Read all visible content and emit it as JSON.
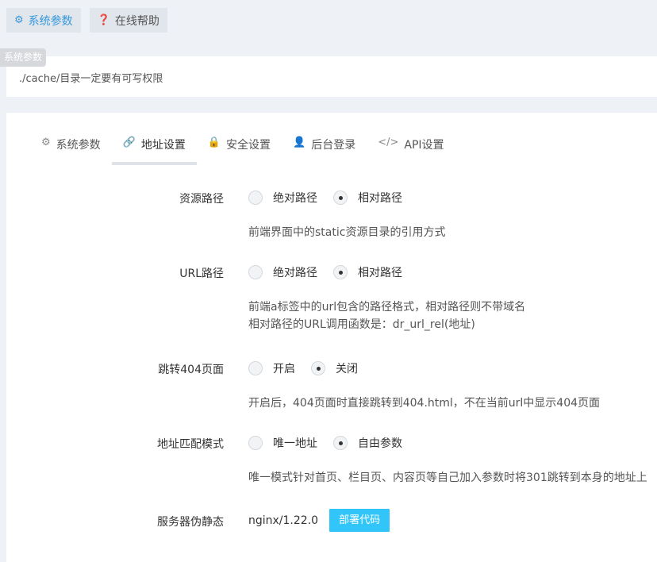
{
  "top_buttons": [
    {
      "label": "系统参数",
      "icon": "gear-icon"
    },
    {
      "label": "在线帮助",
      "icon": "question-circle-icon"
    }
  ],
  "tooltip": "系统参数",
  "note": "./cache/目录一定要有可写权限",
  "tabs": [
    {
      "label": "系统参数",
      "icon": "gear-icon"
    },
    {
      "label": "地址设置",
      "icon": "link-icon"
    },
    {
      "label": "安全设置",
      "icon": "lock-icon"
    },
    {
      "label": "后台登录",
      "icon": "user-icon"
    },
    {
      "label": "API设置",
      "icon": "code-icon"
    }
  ],
  "form": {
    "resource_path": {
      "label": "资源路径",
      "options": [
        "绝对路径",
        "相对路径"
      ],
      "selected": "相对路径",
      "help": "前端界面中的static资源目录的引用方式"
    },
    "url_path": {
      "label": "URL路径",
      "options": [
        "绝对路径",
        "相对路径"
      ],
      "selected": "相对路径",
      "help": [
        "前端a标签中的url包含的路径格式，相对路径则不带域名",
        "相对路径的URL调用函数是：dr_url_rel(地址)"
      ]
    },
    "redirect_404": {
      "label": "跳转404页面",
      "options": [
        "开启",
        "关闭"
      ],
      "selected": "关闭",
      "help": "开启后，404页面时直接跳转到404.html，不在当前url中显示404页面"
    },
    "match_mode": {
      "label": "地址匹配模式",
      "options": [
        "唯一地址",
        "自由参数"
      ],
      "selected": "自由参数",
      "help": "唯一模式针对首页、栏目页、内容页等自己加入参数时将301跳转到本身的地址上"
    },
    "server_rewrite": {
      "label": "服务器伪静态",
      "value": "nginx/1.22.0",
      "button": "部署代码"
    }
  }
}
